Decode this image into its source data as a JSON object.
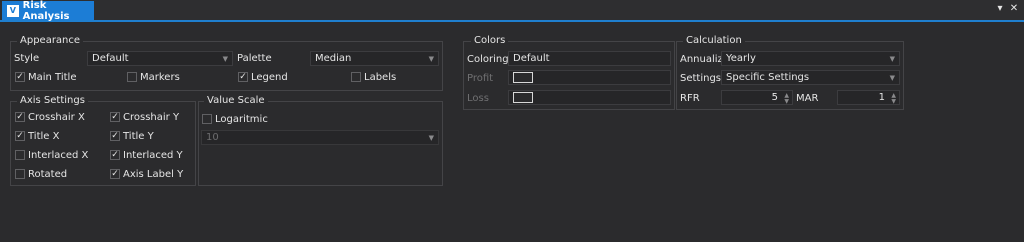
{
  "window": {
    "title": "Risk Analysis",
    "tab_icon": "app-icon",
    "menu_icon": "dropdown-arrow-icon",
    "close_icon": "close-icon"
  },
  "appearance": {
    "title": "Appearance",
    "style_label": "Style",
    "style_value": "Default",
    "palette_label": "Palette",
    "palette_value": "Median",
    "main_title": "Main Title",
    "markers": "Markers",
    "legend": "Legend",
    "labels": "Labels"
  },
  "axis": {
    "title": "Axis Settings",
    "crosshair_x": "Crosshair X",
    "crosshair_y": "Crosshair Y",
    "title_x": "Title X",
    "title_y": "Title Y",
    "interlaced_x": "Interlaced X",
    "interlaced_y": "Interlaced Y",
    "rotated": "Rotated",
    "axis_label_y": "Axis Label Y"
  },
  "value_scale": {
    "title": "Value Scale",
    "logaritmic": "Logaritmic",
    "base_value": "10"
  },
  "colors": {
    "title": "Colors",
    "coloring_label": "Coloring",
    "coloring_value": "Default",
    "profit_label": "Profit",
    "loss_label": "Loss"
  },
  "calculation": {
    "title": "Calculation",
    "annualize_label": "Annualize",
    "annualize_value": "Yearly",
    "settings_label": "Settings",
    "settings_value": "Specific Settings",
    "rfr_label": "RFR",
    "rfr_value": "5",
    "mar_label": "MAR",
    "mar_value": "1"
  },
  "checks": {
    "checked": "✓"
  }
}
